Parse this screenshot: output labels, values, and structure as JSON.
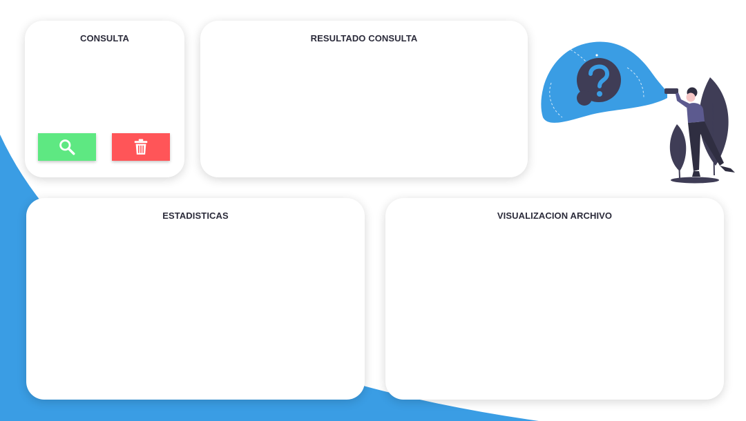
{
  "colors": {
    "background_accent": "#3a9de4",
    "search_button": "#5ee882",
    "delete_button": "#ff5558",
    "title_text": "#2b2b3a"
  },
  "consulta": {
    "title": "CONSULTA",
    "search_button_icon": "search-icon",
    "delete_button_icon": "trash-icon"
  },
  "resultado": {
    "title": "RESULTADO CONSULTA"
  },
  "estadisticas": {
    "title": "ESTADISTICAS"
  },
  "visualizacion": {
    "title": "VISUALIZACION ARCHIVO"
  },
  "illustration": {
    "icon": "question-mark-icon"
  }
}
